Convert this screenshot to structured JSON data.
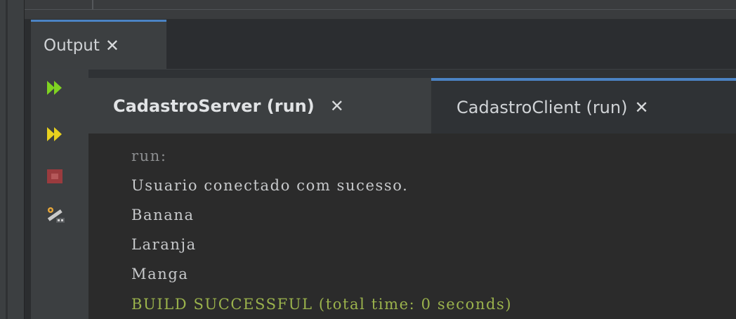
{
  "output_panel": {
    "tab_label": "Output",
    "close_glyph": "✕"
  },
  "toolbar": {
    "icons": [
      "rerun-icon",
      "rerun-with-options-icon",
      "stop-icon",
      "settings-wrench-icon"
    ]
  },
  "run_tabs": [
    {
      "label": "CadastroServer (run)",
      "active": true,
      "close_glyph": "✕"
    },
    {
      "label": "CadastroClient (run)",
      "active": false,
      "close_glyph": "✕"
    }
  ],
  "console": {
    "lines": [
      {
        "text": "run:",
        "kind": "muted"
      },
      {
        "text": "Usuario conectado com sucesso.",
        "kind": "normal"
      },
      {
        "text": "Banana",
        "kind": "normal"
      },
      {
        "text": "Laranja",
        "kind": "normal"
      },
      {
        "text": "Manga",
        "kind": "normal"
      },
      {
        "text": "BUILD SUCCESSFUL (total time: 0 seconds)",
        "kind": "success"
      }
    ]
  },
  "colors": {
    "accent": "#4b83c4",
    "success_text": "#9bb34c",
    "run_icon": "#7fd321"
  }
}
